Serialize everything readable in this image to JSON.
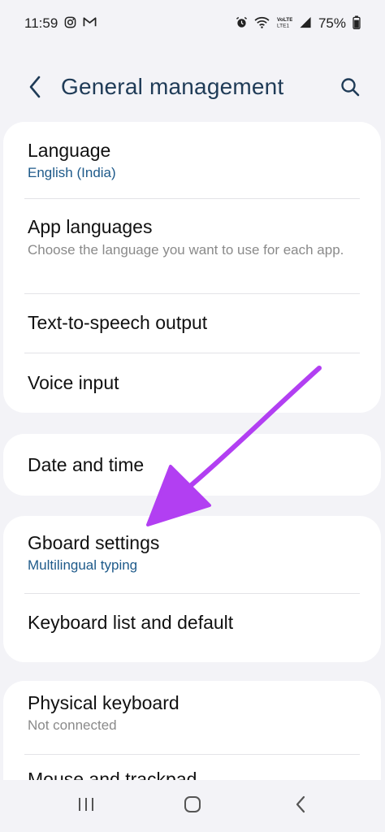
{
  "status_bar": {
    "time": "11:59",
    "battery": "75%",
    "left_icons": [
      "instagram-icon",
      "gmail-icon"
    ],
    "right_icons": [
      "alarm-icon",
      "wifi-icon",
      "volte-icon",
      "signal-icon"
    ]
  },
  "header": {
    "title": "General management",
    "back_icon": "chevron-left-icon",
    "search_icon": "search-icon"
  },
  "groups": [
    {
      "items": [
        {
          "title": "Language",
          "subtitle": "English (India)"
        },
        {
          "title": "App languages",
          "subtitle": "Choose the language you want to use for each app."
        },
        {
          "title": "Text-to-speech output"
        },
        {
          "title": "Voice input"
        }
      ]
    },
    {
      "items": [
        {
          "title": "Date and time"
        }
      ]
    },
    {
      "items": [
        {
          "title": "Gboard settings",
          "subtitle": "Multilingual typing"
        },
        {
          "title": "Keyboard list and default"
        }
      ]
    },
    {
      "items": [
        {
          "title": "Physical keyboard",
          "subtitle": "Not connected"
        },
        {
          "title": "Mouse and trackpad"
        }
      ]
    }
  ],
  "nav_bar": {
    "recents_icon": "recents-icon",
    "home_icon": "home-icon",
    "back_icon": "back-icon"
  },
  "colors": {
    "background": "#f3f3f7",
    "title": "#1f3b57",
    "subtitle_accent": "#1e5a8a",
    "arrow": "#b23ff2"
  }
}
